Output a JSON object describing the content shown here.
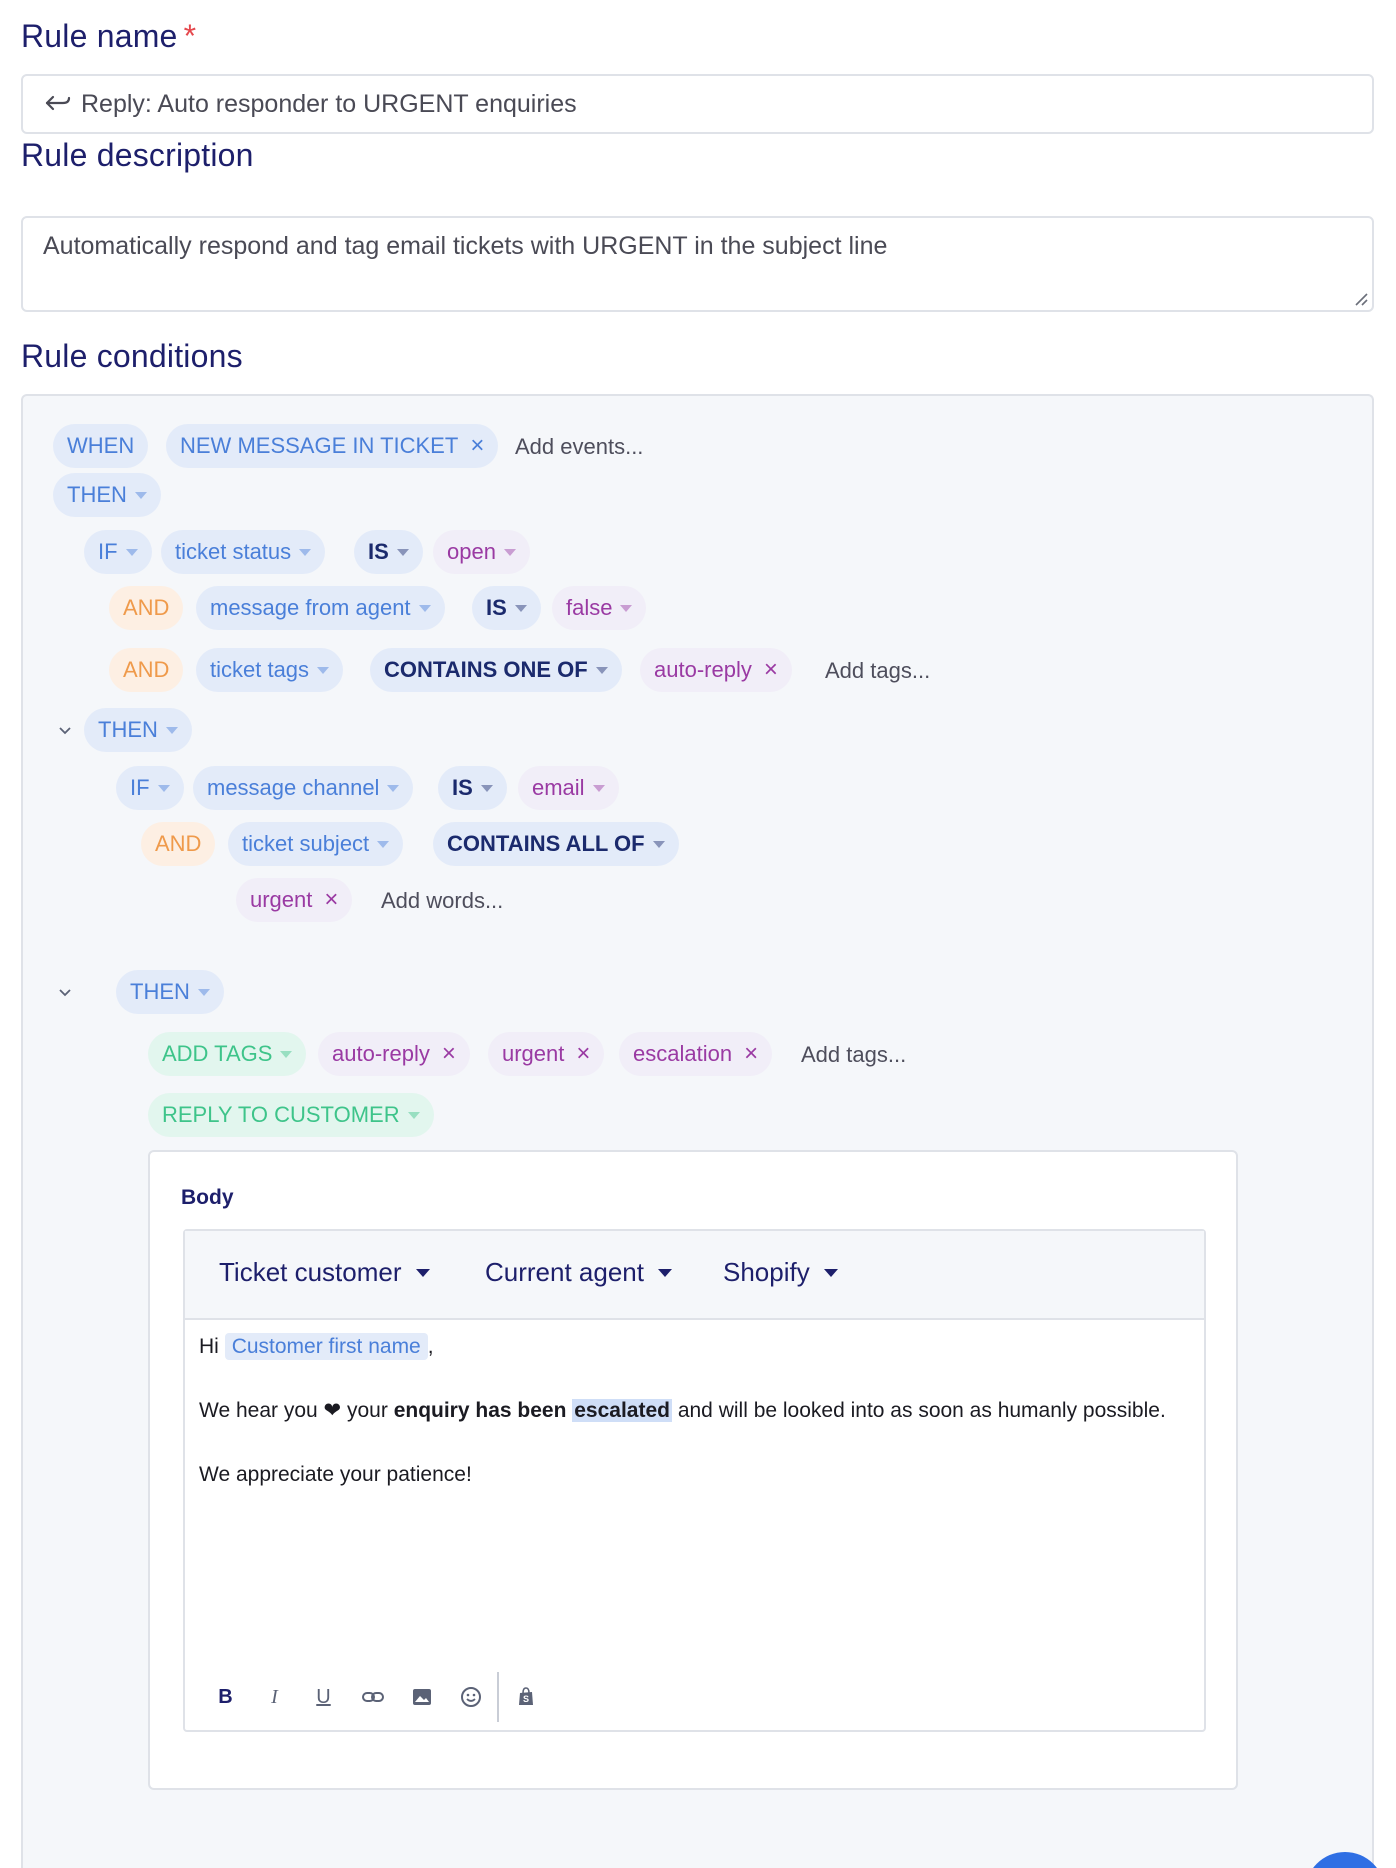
{
  "rule_name": {
    "label": "Rule name",
    "required_mark": "*",
    "value": "Reply: Auto responder to URGENT enquiries"
  },
  "rule_description": {
    "label": "Rule description",
    "value": "Automatically respond and tag email tickets with URGENT in the subject line"
  },
  "rule_conditions": {
    "label": "Rule conditions",
    "when": {
      "keyword": "WHEN",
      "event": "NEW MESSAGE IN TICKET",
      "add_events": "Add events..."
    },
    "then_1": "THEN",
    "if_1": {
      "keyword": "IF",
      "field": "ticket status",
      "operator": "IS",
      "value": "open"
    },
    "and_1": {
      "keyword": "AND",
      "field": "message from agent",
      "operator": "IS",
      "value": "false"
    },
    "and_2": {
      "keyword": "AND",
      "field": "ticket tags",
      "operator": "CONTAINS ONE OF",
      "tag": "auto-reply",
      "add_tags": "Add tags..."
    },
    "then_2": "THEN",
    "if_2": {
      "keyword": "IF",
      "field": "message channel",
      "operator": "IS",
      "value": "email"
    },
    "and_3": {
      "keyword": "AND",
      "field": "ticket subject",
      "operator": "CONTAINS ALL OF",
      "word": "urgent",
      "add_words": "Add words..."
    },
    "then_3": "THEN",
    "add_tags_action": {
      "label": "ADD TAGS",
      "tags": [
        "auto-reply",
        "urgent",
        "escalation"
      ],
      "add_tags": "Add tags..."
    },
    "reply_action": {
      "label": "REPLY TO CUSTOMER",
      "body_label": "Body",
      "variables": [
        "Ticket customer",
        "Current agent",
        "Shopify"
      ],
      "greeting_prefix": "Hi",
      "greeting_variable": "Customer first name",
      "greeting_suffix": ",",
      "line2_a": "We hear you",
      "line2_heart": "❤",
      "line2_b": "your",
      "line2_bold": "enquiry has been",
      "line2_selected": "escalated",
      "line2_c": "and will be looked into as soon as humanly possible.",
      "line3": "We appreciate your patience!",
      "format_buttons": [
        "bold",
        "italic",
        "underline",
        "link",
        "image",
        "emoji",
        "shopify"
      ]
    }
  },
  "colors": {
    "label": "#1d1f6b",
    "required": "#e5484d",
    "blue_pill": "#4a7fd9",
    "purple_pill": "#9a3aa3",
    "orange_pill": "#ef9a4b",
    "green_pill": "#3ec48a",
    "fab": "#2f6fe4"
  }
}
